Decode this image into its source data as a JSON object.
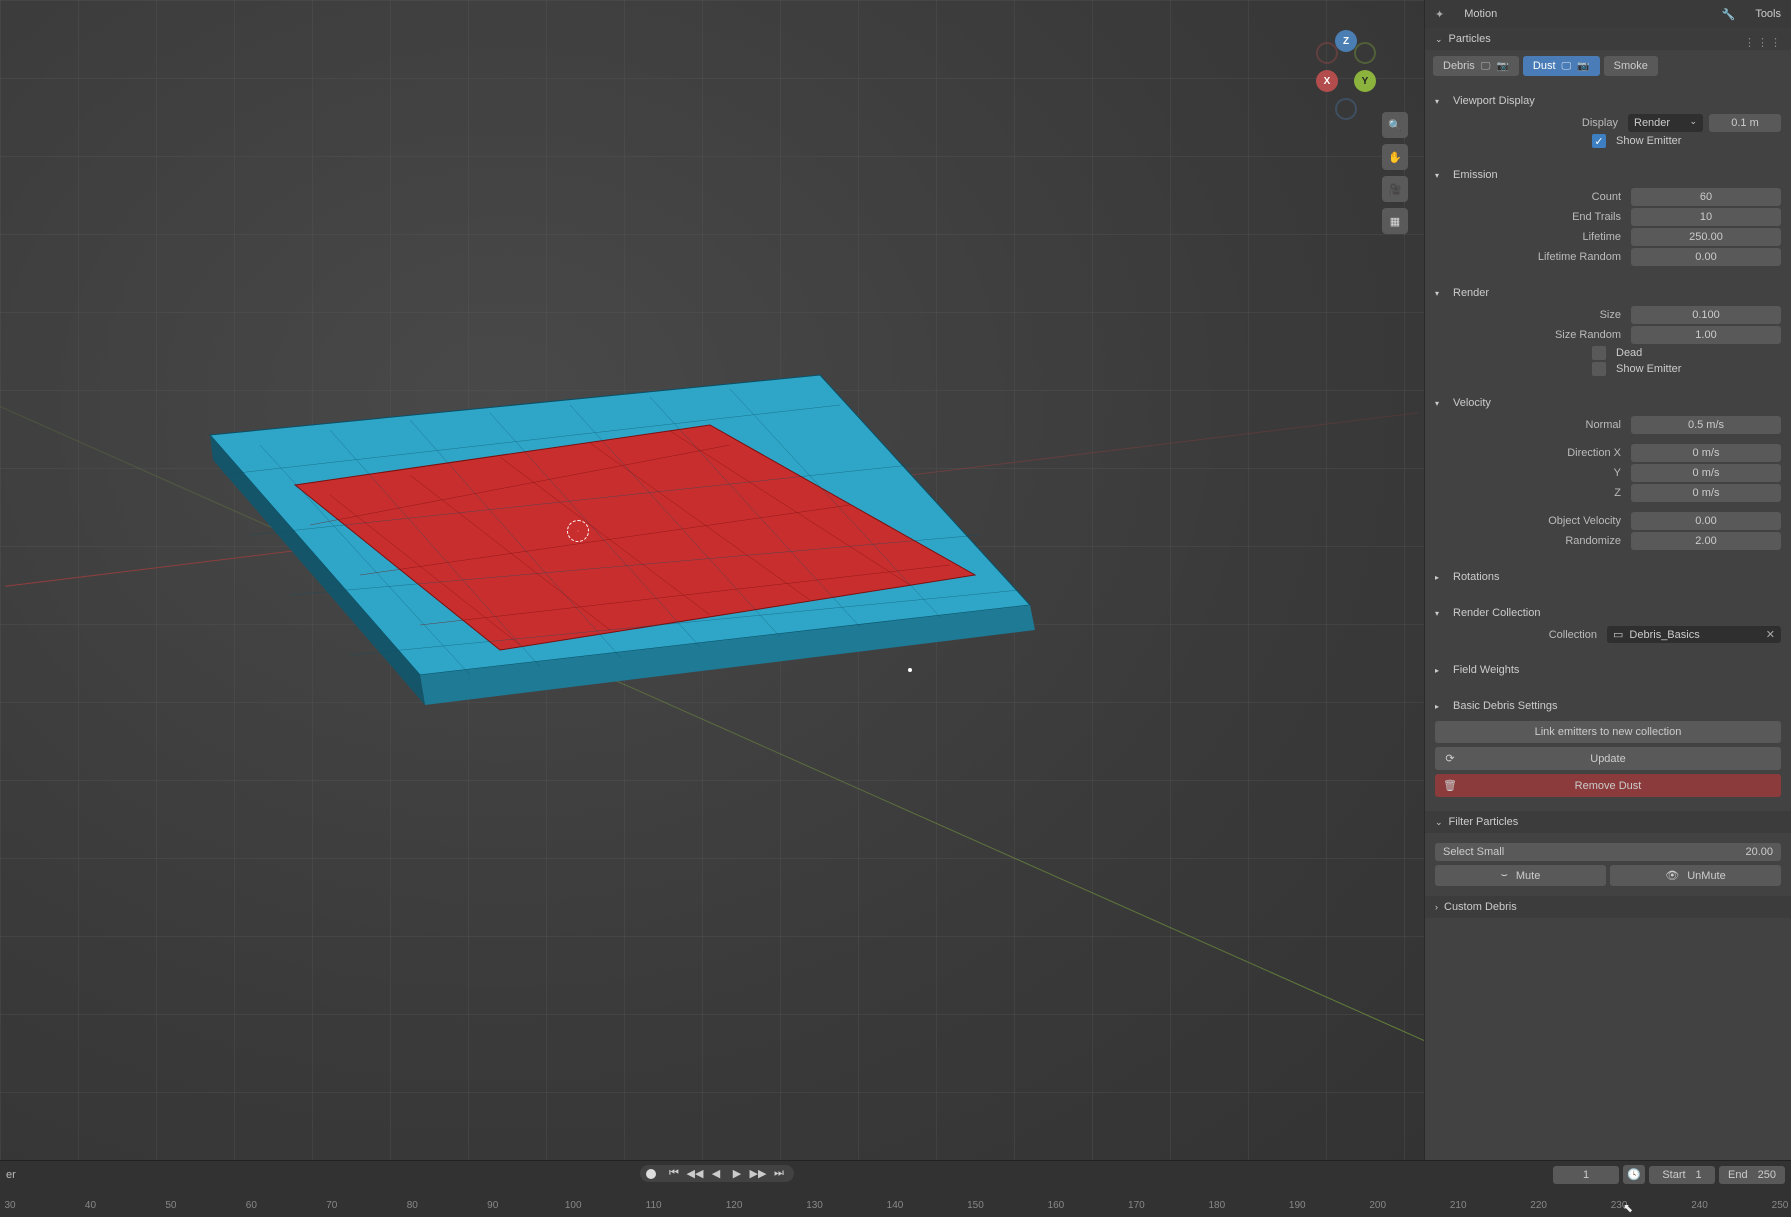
{
  "top_tabs": {
    "motion": "Motion",
    "tools": "Tools"
  },
  "panel_title": "Particles",
  "chips": {
    "debris": "Debris",
    "dust": "Dust",
    "smoke": "Smoke"
  },
  "viewport_display": {
    "title": "Viewport Display",
    "display_label": "Display",
    "display_value": "Render",
    "unit_value": "0.1 m",
    "show_emitter": "Show Emitter"
  },
  "emission": {
    "title": "Emission",
    "count_label": "Count",
    "count": "60",
    "end_trails_label": "End Trails",
    "end_trails": "10",
    "lifetime_label": "Lifetime",
    "lifetime": "250.00",
    "lifetime_random_label": "Lifetime Random",
    "lifetime_random": "0.00"
  },
  "render": {
    "title": "Render",
    "size_label": "Size",
    "size": "0.100",
    "size_random_label": "Size Random",
    "size_random": "1.00",
    "dead": "Dead",
    "show_emitter": "Show Emitter"
  },
  "velocity": {
    "title": "Velocity",
    "normal_label": "Normal",
    "normal": "0.5 m/s",
    "dx_label": "Direction X",
    "dx": "0 m/s",
    "dy_label": "Y",
    "dy": "0 m/s",
    "dz_label": "Z",
    "dz": "0 m/s",
    "obj_label": "Object Velocity",
    "obj": "0.00",
    "rand_label": "Randomize",
    "rand": "2.00"
  },
  "rotations": {
    "title": "Rotations"
  },
  "render_collection": {
    "title": "Render Collection",
    "label": "Collection",
    "value": "Debris_Basics"
  },
  "field_weights": {
    "title": "Field Weights"
  },
  "basic_debris": {
    "title": "Basic Debris Settings"
  },
  "buttons": {
    "link_emitters": "Link emitters to new collection",
    "update": "Update",
    "remove_dust": "Remove Dust"
  },
  "filter_particles": {
    "title": "Filter Particles",
    "select_small": "Select Small",
    "select_small_val": "20.00",
    "mute": "Mute",
    "unmute": "UnMute"
  },
  "custom_debris": {
    "title": "Custom Debris"
  },
  "gizmo": {
    "z": "Z",
    "y": "Y",
    "x": "X"
  },
  "timeline": {
    "left": "er",
    "frame": "1",
    "start_label": "Start",
    "start": "1",
    "end_label": "End",
    "end": "250",
    "ticks": [
      "30",
      "40",
      "50",
      "60",
      "70",
      "80",
      "90",
      "100",
      "110",
      "120",
      "130",
      "140",
      "150",
      "160",
      "170",
      "180",
      "190",
      "200",
      "210",
      "220",
      "230",
      "240",
      "250"
    ]
  }
}
